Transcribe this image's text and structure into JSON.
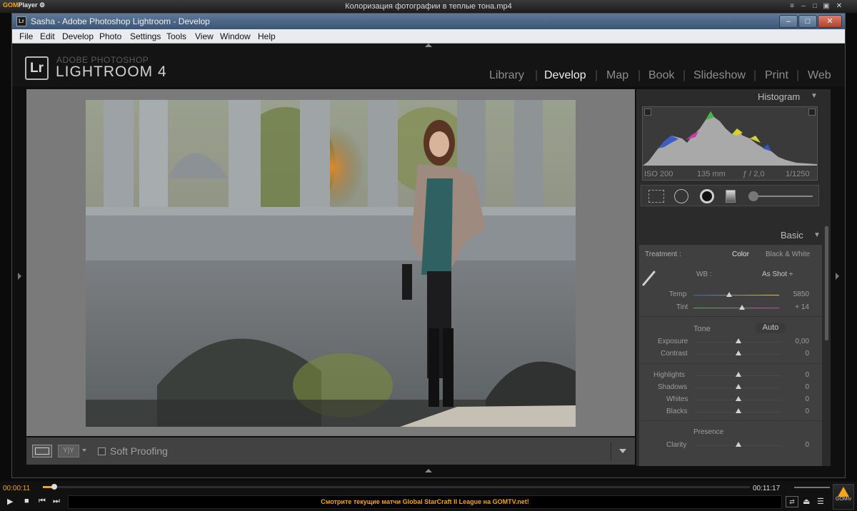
{
  "player": {
    "logo_brand": "GOM",
    "logo_suffix": "Player",
    "window_title": "Колоризация фотографии в теплые тона.mp4",
    "time_current": "00:00:11",
    "time_total": "00:11:17",
    "progress_fraction": 0.016,
    "ticker": "Смотрите текущие матчи Global StarCraft II League на GOMTV.net!",
    "gomtv_label": "GOMtv"
  },
  "lightroom": {
    "window_title": "Sasha - Adobe Photoshop Lightroom - Develop",
    "app_icon": "Lr",
    "menu": [
      "File",
      "Edit",
      "Develop",
      "Photo",
      "Settings",
      "Tools",
      "View",
      "Window",
      "Help"
    ],
    "logo_letters": "Lr",
    "brand_small": "ADOBE PHOTOSHOP",
    "brand_big": "LIGHTROOM 4",
    "modules": [
      "Library",
      "Develop",
      "Map",
      "Book",
      "Slideshow",
      "Print",
      "Web"
    ],
    "active_module": "Develop"
  },
  "toolbar": {
    "soft_proofing": "Soft Proofing"
  },
  "histogram": {
    "title": "Histogram",
    "iso": "ISO 200",
    "focal": "135 mm",
    "aperture": "ƒ / 2,0",
    "shutter": "1/1250"
  },
  "basic": {
    "title": "Basic",
    "treatment_label": "Treatment :",
    "color": "Color",
    "bw": "Black & White",
    "wb_label": "WB :",
    "wb_value": "As Shot ÷",
    "temp_label": "Temp",
    "temp_value": "5850",
    "tint_label": "Tint",
    "tint_value": "+ 14",
    "tone_label": "Tone",
    "auto": "Auto",
    "exposure_label": "Exposure",
    "exposure_value": "0,00",
    "contrast_label": "Contrast",
    "contrast_value": "0",
    "highlights_label": "Highlights",
    "highlights_value": "0",
    "shadows_label": "Shadows",
    "shadows_value": "0",
    "whites_label": "Whites",
    "whites_value": "0",
    "blacks_label": "Blacks",
    "blacks_value": "0",
    "presence_label": "Presence",
    "clarity_label": "Clarity",
    "clarity_value": "0"
  },
  "icons": {
    "eyedropper": "eyedropper-icon",
    "crop": "crop-icon",
    "spot": "spot-removal-icon",
    "redeye": "red-eye-icon",
    "gradient": "graduated-filter-icon",
    "brush": "adjustment-brush-icon"
  },
  "colors": {
    "player_accent": "#f6a31b",
    "lr_panel": "#2b2b2b",
    "lr_center": "#7a7a7a"
  }
}
